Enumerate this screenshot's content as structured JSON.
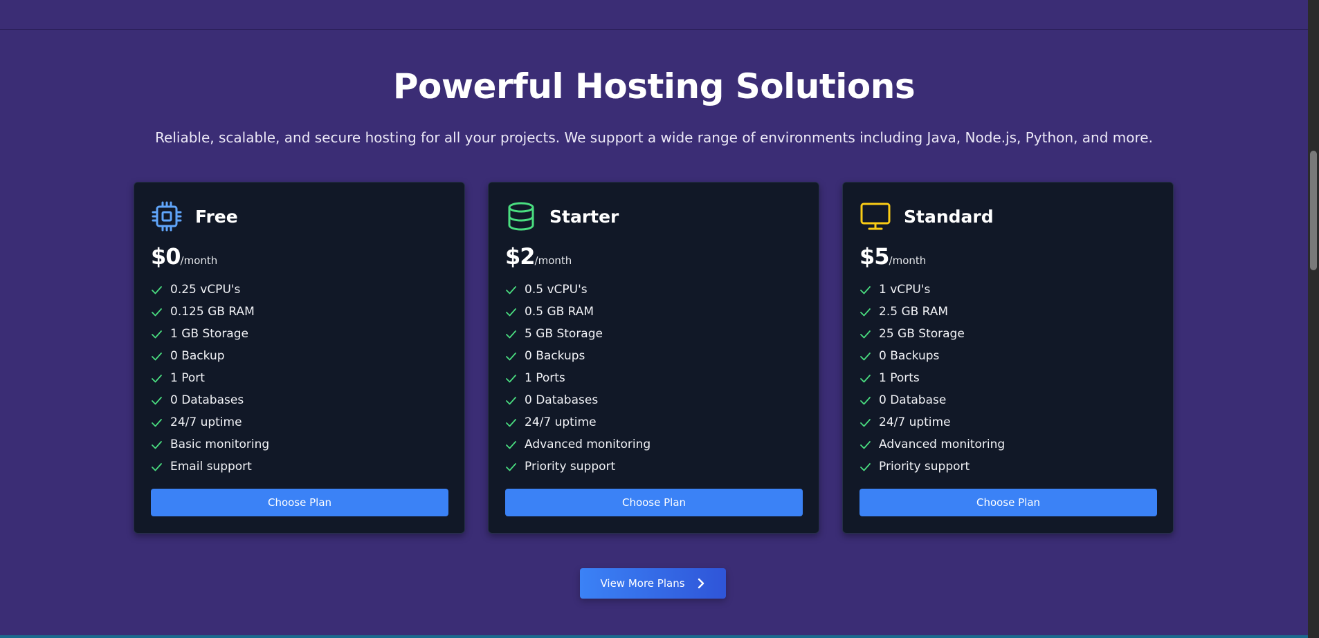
{
  "section": {
    "title": "Powerful Hosting Solutions",
    "subtitle": "Reliable, scalable, and secure hosting for all your projects. We support a wide range of environments including Java, Node.js, Python, and more."
  },
  "plans": [
    {
      "name": "Free",
      "icon": "cpu-chip-icon",
      "icon_color": "#60a5fa",
      "price": "$0",
      "period": "/month",
      "features": [
        "0.25 vCPU's",
        "0.125 GB RAM",
        "1 GB Storage",
        "0 Backup",
        "1 Port",
        "0 Databases",
        "24/7 uptime",
        "Basic monitoring",
        "Email support"
      ],
      "button_label": "Choose Plan"
    },
    {
      "name": "Starter",
      "icon": "database-icon",
      "icon_color": "#4ade80",
      "price": "$2",
      "period": "/month",
      "features": [
        "0.5 vCPU's",
        "0.5 GB RAM",
        "5 GB Storage",
        "0 Backups",
        "1 Ports",
        "0 Databases",
        "24/7 uptime",
        "Advanced monitoring",
        "Priority support"
      ],
      "button_label": "Choose Plan"
    },
    {
      "name": "Standard",
      "icon": "monitor-icon",
      "icon_color": "#facc15",
      "price": "$5",
      "period": "/month",
      "features": [
        "1 vCPU's",
        "2.5 GB RAM",
        "25 GB Storage",
        "0 Backups",
        "1 Ports",
        "0 Database",
        "24/7 uptime",
        "Advanced monitoring",
        "Priority support"
      ],
      "button_label": "Choose Plan"
    }
  ],
  "more_button": {
    "label": "View More Plans",
    "icon": "chevron-right-icon"
  },
  "colors": {
    "background": "#3b2d75",
    "card": "#111827",
    "accent": "#3b82f6",
    "check": "#4ade80"
  }
}
